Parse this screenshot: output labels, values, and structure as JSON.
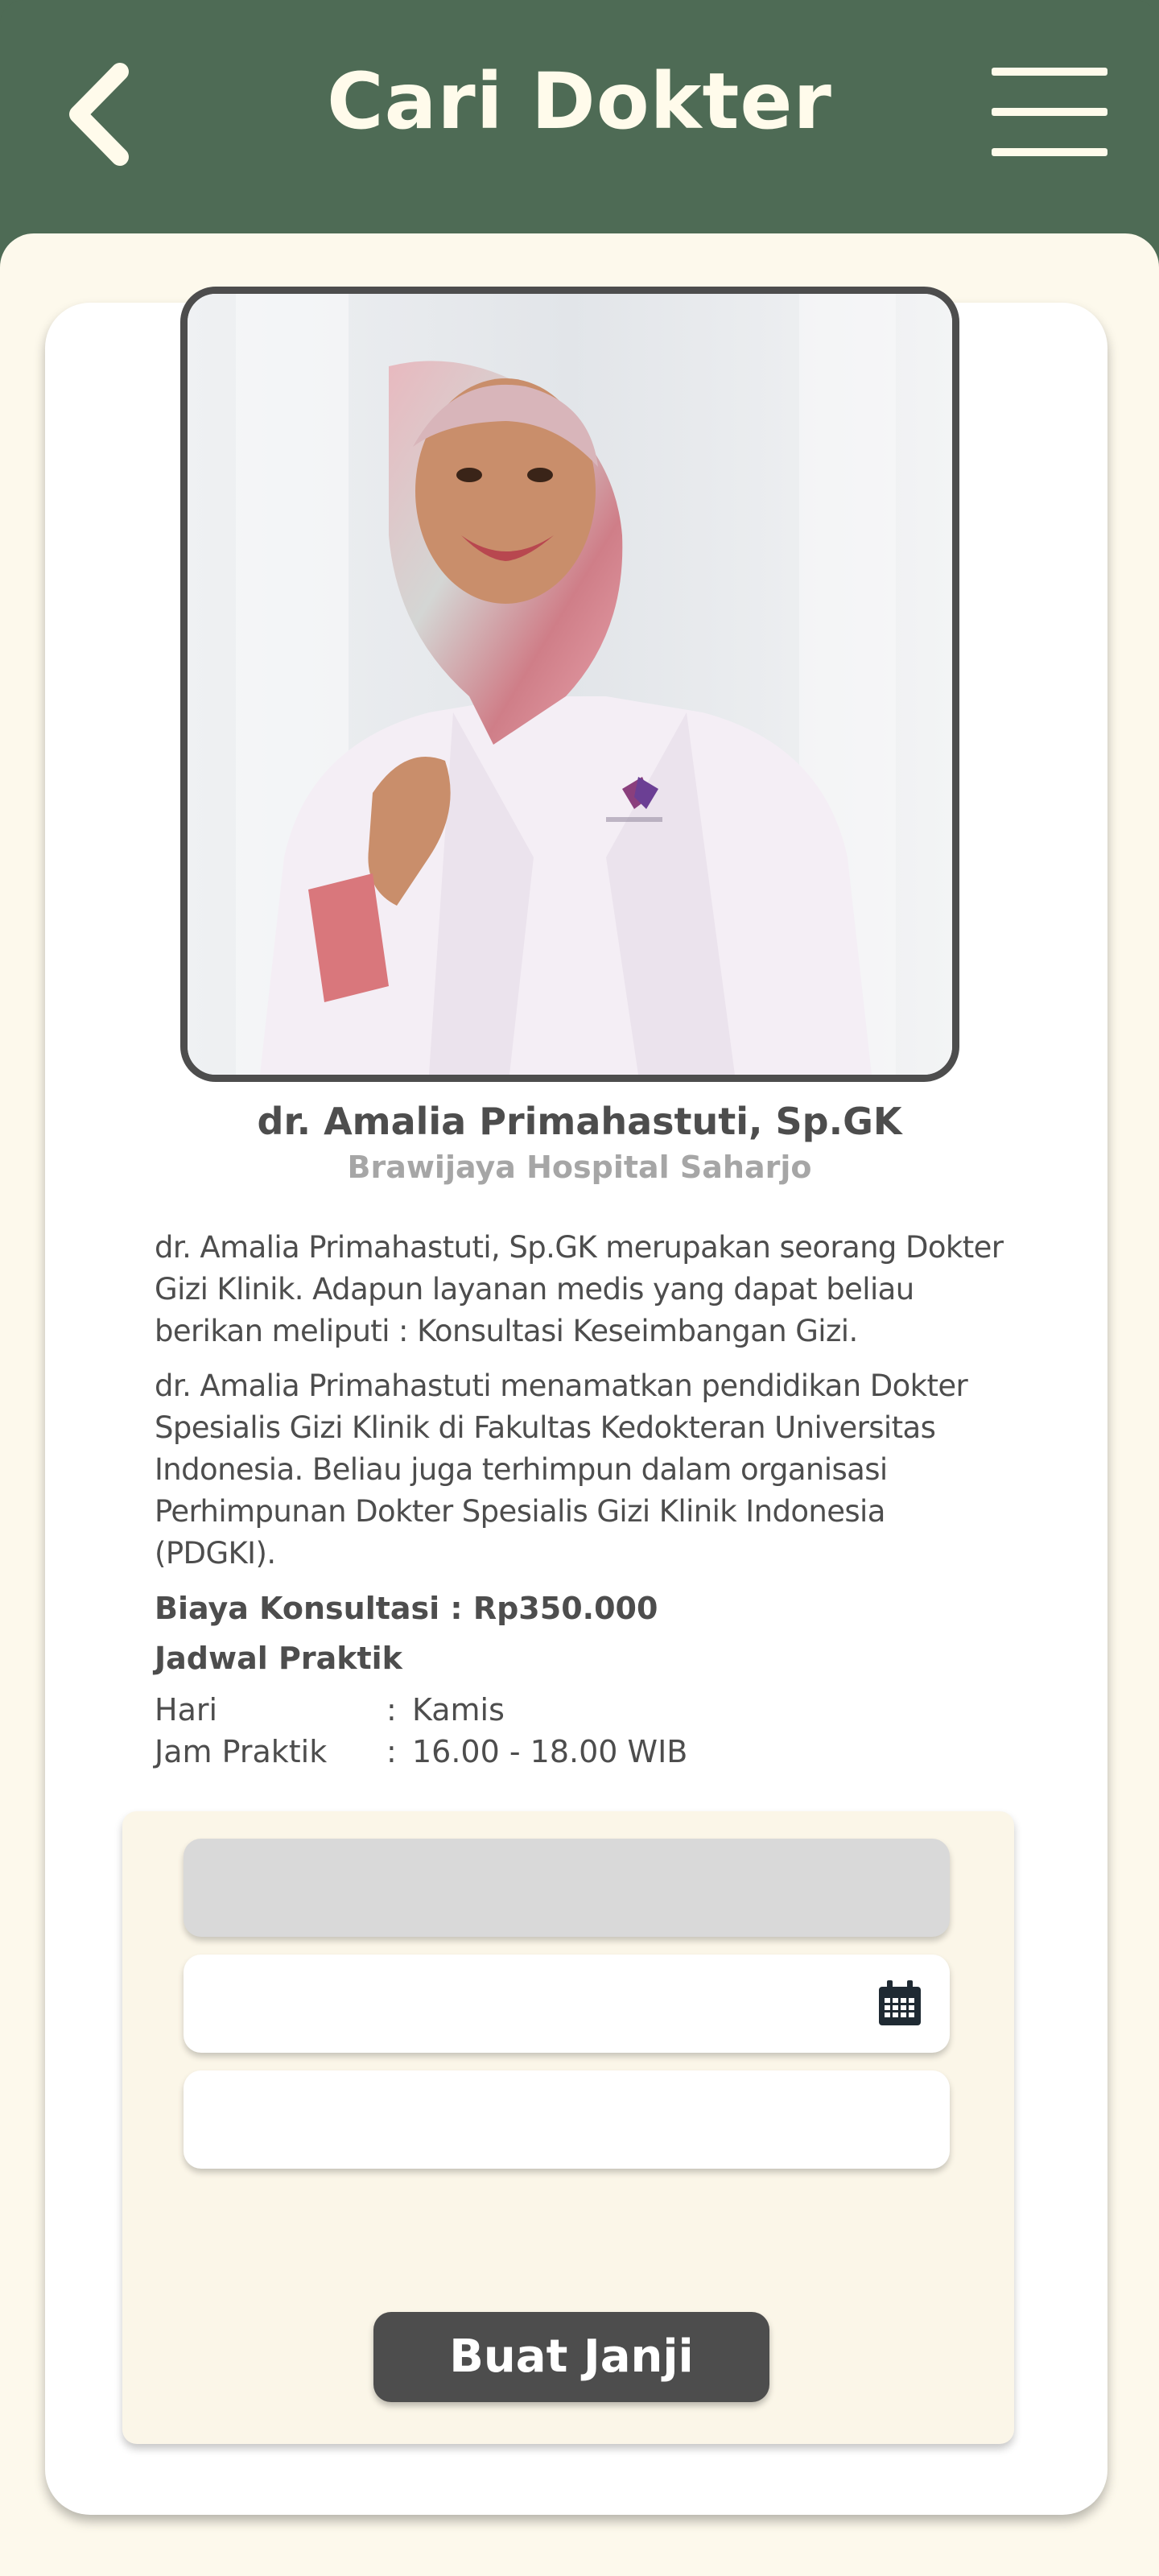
{
  "header": {
    "title": "Cari Dokter",
    "back_icon": "chevron-left-icon",
    "menu_icon": "hamburger-menu-icon"
  },
  "doctor": {
    "name": "dr. Amalia Primahastuti, Sp.GK",
    "hospital": "Brawijaya Hospital Saharjo",
    "description_1": "dr. Amalia Primahastuti, Sp.GK merupakan seorang Dokter Gizi Klinik. Adapun layanan medis yang dapat beliau berikan meliputi : Konsultasi Keseimbangan Gizi.",
    "description_2": "dr. Amalia Primahastuti menamatkan pendidikan Dokter Spesialis Gizi Klinik di Fakultas Kedokteran Universitas Indonesia. Beliau juga terhimpun dalam organisasi Perhimpunan Dokter Spesialis Gizi Klinik Indonesia (PDGKI).",
    "fee": "Biaya Konsultasi : Rp350.000"
  },
  "schedule": {
    "title": "Jadwal Praktik",
    "separator": ":",
    "rows": [
      {
        "label": "Hari",
        "value": "Kamis"
      },
      {
        "label": "Jam Praktik",
        "value": "16.00 - 18.00 WIB"
      }
    ]
  },
  "form": {
    "date_icon": "calendar-icon",
    "submit_label": "Buat Janji"
  },
  "colors": {
    "header_bg": "#4e6b55",
    "page_bg": "#fdf9ec",
    "text_primary": "#4d4d4d",
    "text_secondary": "#a6a6a6",
    "button_bg": "#4d4d4d"
  }
}
